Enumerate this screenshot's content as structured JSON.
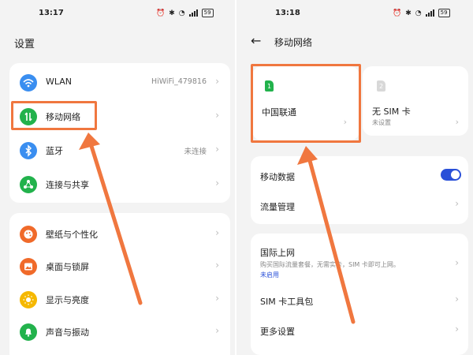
{
  "left": {
    "status": {
      "time": "13:17",
      "battery": "59"
    },
    "title": "设置",
    "group1": [
      {
        "label": "WLAN",
        "value": "HiWiFi_479816",
        "icon": "wifi-icon",
        "color": "#3a8ef0"
      },
      {
        "label": "移动网络",
        "value": "",
        "icon": "mobile-data-icon",
        "color": "#22b24c"
      },
      {
        "label": "蓝牙",
        "value": "未连接",
        "icon": "bluetooth-icon",
        "color": "#3a8ef0"
      },
      {
        "label": "连接与共享",
        "value": "",
        "icon": "share-icon",
        "color": "#22b24c"
      }
    ],
    "group2": [
      {
        "label": "壁纸与个性化",
        "icon": "palette-icon",
        "color": "#f06a2a"
      },
      {
        "label": "桌面与锁屏",
        "icon": "image-icon",
        "color": "#f06a2a"
      },
      {
        "label": "显示与亮度",
        "icon": "sun-icon",
        "color": "#f5b800"
      },
      {
        "label": "声音与振动",
        "icon": "bell-icon",
        "color": "#22b24c"
      }
    ]
  },
  "right": {
    "status": {
      "time": "13:18",
      "battery": "59"
    },
    "title": "移动网络",
    "sim1": {
      "num": "1",
      "name": "中国联通",
      "color": "#22b24c"
    },
    "sim2": {
      "num": "2",
      "name": "无 SIM 卡",
      "sub": "未设置",
      "color": "#d8d8d8"
    },
    "mobile_data": {
      "label": "移动数据",
      "on": true
    },
    "data_usage": "流量管理",
    "roaming": {
      "label": "国际上网",
      "desc": "购买国际流量套餐，无需实卡，SIM 卡即可上网。",
      "status": "未启用"
    },
    "sim_toolkit": "SIM 卡工具包",
    "more": "更多设置"
  },
  "accent": "#f0773f"
}
